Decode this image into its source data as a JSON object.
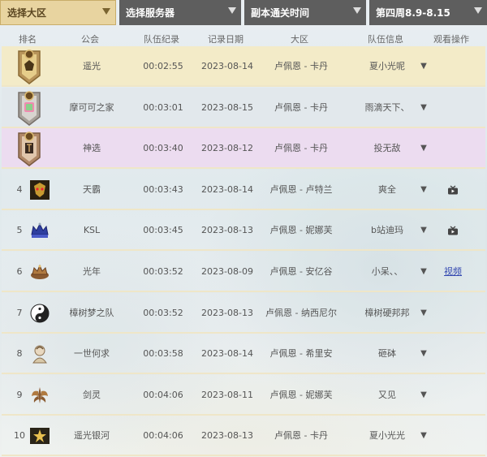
{
  "filters": {
    "region": "选择大区",
    "server": "选择服务器",
    "metric": "副本通关时间",
    "week": "第四周8.9-8.15"
  },
  "header": {
    "rank": "排名",
    "guild": "公会",
    "record": "队伍纪录",
    "date": "记录日期",
    "region": "大区",
    "team": "队伍信息",
    "watch": "观看操作"
  },
  "toggle_glyph": "▼",
  "rows": [
    {
      "rank": "",
      "medal": "gold",
      "guild": "遥光",
      "time": "00:02:55",
      "date": "2023-08-14",
      "region": "卢佩恩 - 卡丹",
      "leader": "夏小光呢",
      "watch": ""
    },
    {
      "rank": "",
      "medal": "silver",
      "guild": "摩可可之家",
      "time": "00:03:01",
      "date": "2023-08-15",
      "region": "卢佩恩 - 卡丹",
      "leader": "雨滴天下、",
      "watch": ""
    },
    {
      "rank": "",
      "medal": "bronze",
      "guild": "神选",
      "time": "00:03:40",
      "date": "2023-08-12",
      "region": "卢佩恩 - 卡丹",
      "leader": "投无敌",
      "watch": ""
    },
    {
      "rank": "4",
      "emblem": "demon-emblem",
      "guild": "天霸",
      "time": "00:03:43",
      "date": "2023-08-14",
      "region": "卢佩恩 - 卢特兰",
      "leader": "爽全",
      "watch": "tv"
    },
    {
      "rank": "5",
      "emblem": "crown-emblem",
      "guild": "KSL",
      "time": "00:03:45",
      "date": "2023-08-13",
      "region": "卢佩恩 - 妮娜芙",
      "leader": "b站迪玛",
      "watch": "tv"
    },
    {
      "rank": "6",
      "emblem": "brown-crown-emblem",
      "guild": "光年",
      "time": "00:03:52",
      "date": "2023-08-09",
      "region": "卢佩恩 - 安亿谷",
      "leader": "小呆、、",
      "watch": "link"
    },
    {
      "rank": "7",
      "emblem": "yin-yang-emblem",
      "guild": "樟树梦之队",
      "time": "00:03:52",
      "date": "2023-08-13",
      "region": "卢佩恩 - 纳西尼尔",
      "leader": "樟树硬邦邦",
      "watch": ""
    },
    {
      "rank": "8",
      "emblem": "character-emblem",
      "guild": "一世何求",
      "time": "00:03:58",
      "date": "2023-08-14",
      "region": "卢佩恩 - 希里安",
      "leader": "砸砵",
      "watch": ""
    },
    {
      "rank": "9",
      "emblem": "wing-emblem",
      "guild": "剑灵",
      "time": "00:04:06",
      "date": "2023-08-11",
      "region": "卢佩恩 - 妮娜芙",
      "leader": "又见",
      "watch": ""
    },
    {
      "rank": "10",
      "emblem": "gold-star-emblem",
      "guild": "遥光银河",
      "time": "00:04:06",
      "date": "2023-08-13",
      "region": "卢佩恩 - 卡丹",
      "leader": "夏小光光",
      "watch": ""
    }
  ],
  "video_link_label": "视频",
  "colors": {
    "gold_row": "#f3ebc8",
    "silver_row": "#e2e8ec",
    "bronze_row": "#ecdcf0",
    "dropdown_dark": "#5e5e5e",
    "dropdown_active": "#e8d4a0",
    "link": "#3348b0"
  }
}
